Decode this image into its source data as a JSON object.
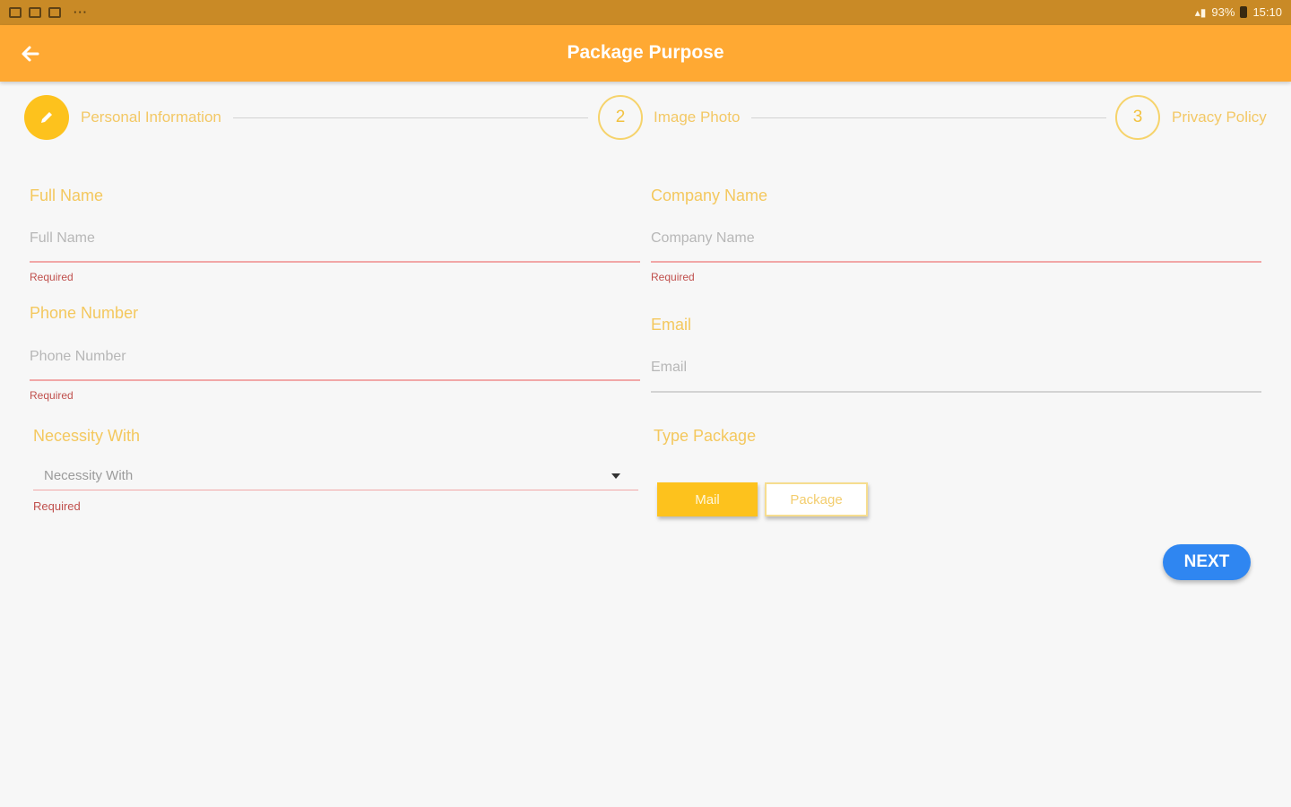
{
  "status_bar": {
    "left_icons": [
      "gallery-icon",
      "sim-icon",
      "bag-icon"
    ],
    "more": "···",
    "battery_percent": "93%",
    "time": "15:10"
  },
  "app_bar": {
    "title": "Package Purpose",
    "background": "#ffa933"
  },
  "stepper": {
    "steps": [
      {
        "number": "1",
        "label": "Personal Information",
        "state": "active",
        "icon": "pencil-icon"
      },
      {
        "number": "2",
        "label": "Image Photo",
        "state": "pending"
      },
      {
        "number": "3",
        "label": "Privacy Policy",
        "state": "pending"
      }
    ]
  },
  "form": {
    "full_name": {
      "label": "Full Name",
      "placeholder": "Full Name",
      "value": "",
      "error": "Required"
    },
    "company_name": {
      "label": "Company Name",
      "placeholder": "Company Name",
      "value": "",
      "error": "Required"
    },
    "phone_number": {
      "label": "Phone Number",
      "placeholder": "Phone Number",
      "value": "",
      "error": "Required"
    },
    "email": {
      "label": "Email",
      "placeholder": "Email",
      "value": ""
    },
    "necessity_with": {
      "label": "Necessity With",
      "selected": "Necessity With",
      "error": "Required"
    },
    "type_package": {
      "label": "Type Package",
      "options": [
        {
          "label": "Mail",
          "selected": true
        },
        {
          "label": "Package",
          "selected": false
        }
      ]
    }
  },
  "next_button": {
    "label": "NEXT",
    "color": "#2f86f1"
  },
  "colors": {
    "accent": "#fdc21d",
    "error": "#c0504d"
  }
}
